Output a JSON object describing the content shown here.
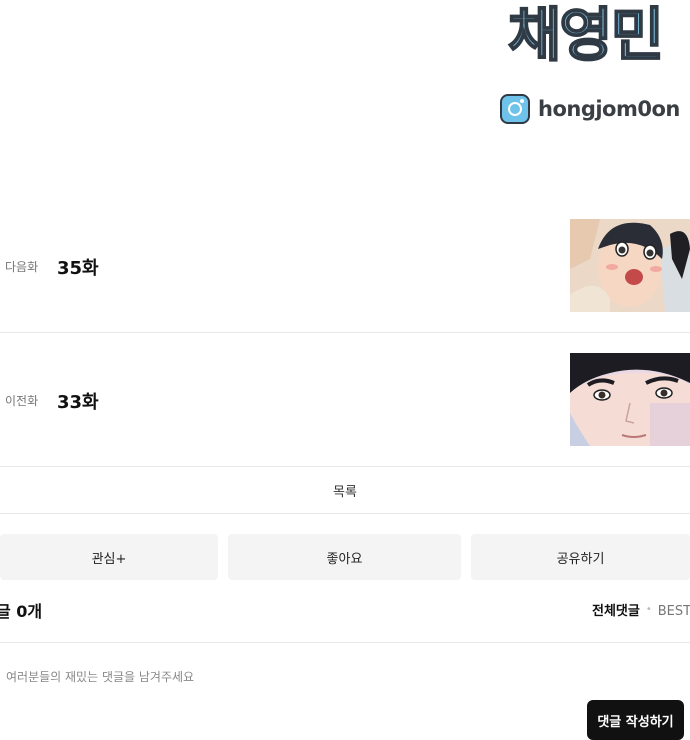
{
  "author": {
    "name": "채영민",
    "instagram_handle": "hongjom0on"
  },
  "episodes": [
    {
      "label": "다음화",
      "title": "35화"
    },
    {
      "label": "이전화",
      "title": "33화"
    }
  ],
  "list_label": "목록",
  "actions": {
    "interest": "관심+",
    "like": "좋아요",
    "share": "공유하기"
  },
  "comments": {
    "count_label": "글 0개",
    "tab_all": "전체댓글",
    "tab_best": "BEST댓",
    "placeholder": "여러분들의 재밌는 댓글을 남겨주세요",
    "write_button": "댓글 작성하기"
  },
  "colors": {
    "accent_blue": "#7fc4e6",
    "button_bg": "#f4f4f4",
    "write_button_bg": "#111111"
  }
}
